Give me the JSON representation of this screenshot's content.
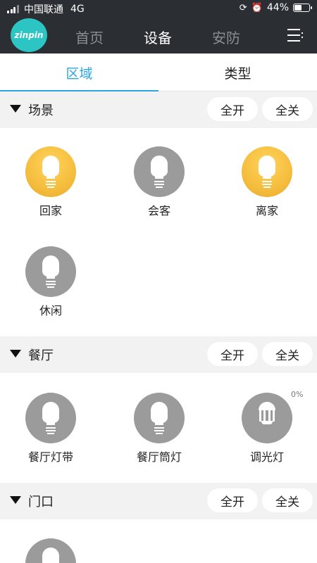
{
  "status_bar": {
    "carrier": "中国联通",
    "network": "4G",
    "icons": [
      "orientation-lock-icon",
      "alarm-icon"
    ],
    "battery_pct": "44%",
    "battery_level": 0.44
  },
  "header": {
    "logo_text": "zinpin",
    "tabs": [
      {
        "label": "首页"
      },
      {
        "label": "设备"
      },
      {
        "label": "安防"
      }
    ],
    "active_tab": "设备",
    "menu_icon": "menu-icon"
  },
  "sub_tabs": {
    "items": [
      {
        "label": "区域"
      },
      {
        "label": "类型"
      }
    ],
    "active": "区域",
    "accent_color": "#2aa7e0"
  },
  "sections": [
    {
      "title": "场景",
      "all_on": "全开",
      "all_off": "全关",
      "devices": [
        {
          "label": "回家",
          "state": "on",
          "icon": "bulb-icon"
        },
        {
          "label": "会客",
          "state": "off",
          "icon": "bulb-icon"
        },
        {
          "label": "离家",
          "state": "on",
          "icon": "bulb-icon"
        },
        {
          "label": "休闲",
          "state": "off",
          "icon": "bulb-icon"
        }
      ]
    },
    {
      "title": "餐厅",
      "all_on": "全开",
      "all_off": "全关",
      "devices": [
        {
          "label": "餐厅灯带",
          "state": "off",
          "icon": "bulb-icon"
        },
        {
          "label": "餐厅筒灯",
          "state": "off",
          "icon": "bulb-icon"
        },
        {
          "label": "调光灯",
          "state": "off",
          "icon": "led-bulb-icon",
          "level": "0%"
        }
      ]
    },
    {
      "title": "门口",
      "all_on": "全开",
      "all_off": "全关",
      "devices": [
        {
          "label": "",
          "state": "off",
          "icon": "bulb-icon"
        }
      ]
    }
  ],
  "colors": {
    "header_bg": "#2b2e33",
    "on_color": "#f5bd3e",
    "off_color": "#9b9b9b",
    "section_bg": "#f2f2f2"
  }
}
